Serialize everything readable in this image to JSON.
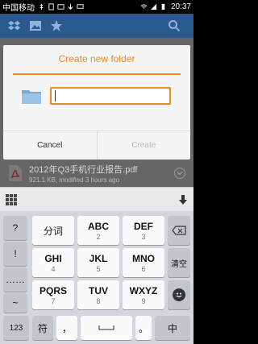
{
  "status_bar": {
    "carrier": "中国移动",
    "time": "20:37"
  },
  "action_bar": {
    "icons": [
      "dropbox-icon",
      "image-icon",
      "star-icon",
      "search-icon"
    ]
  },
  "file_list": {
    "items": [
      {
        "name": "2012年Q3手机行业报告.pdf",
        "meta": "921.1 KB, modified 3 hours ago"
      }
    ]
  },
  "dialog": {
    "title": "Create new folder",
    "input_value": "",
    "cancel_label": "Cancel",
    "create_label": "Create"
  },
  "keyboard": {
    "row1": {
      "side": "?",
      "k1": "分词",
      "k2": "ABC",
      "k2_sub": "2",
      "k3": "DEF",
      "k3_sub": "3"
    },
    "row2": {
      "side": "!",
      "k1": "GHI",
      "k1_sub": "4",
      "k2": "JKL",
      "k2_sub": "5",
      "k3": "MNO",
      "k3_sub": "6",
      "right": "清空"
    },
    "row3": {
      "side": "……",
      "k1": "PQRS",
      "k1_sub": "7",
      "k2": "TUV",
      "k2_sub": "8",
      "k3": "WXYZ",
      "k3_sub": "9"
    },
    "row4": {
      "side": "~",
      "k1": "123",
      "k2": "符",
      "k3": "，",
      "k5": "。",
      "k6": "中"
    }
  },
  "colors": {
    "accent": "#f08a1e",
    "action_bar": "#2a5a8e"
  }
}
